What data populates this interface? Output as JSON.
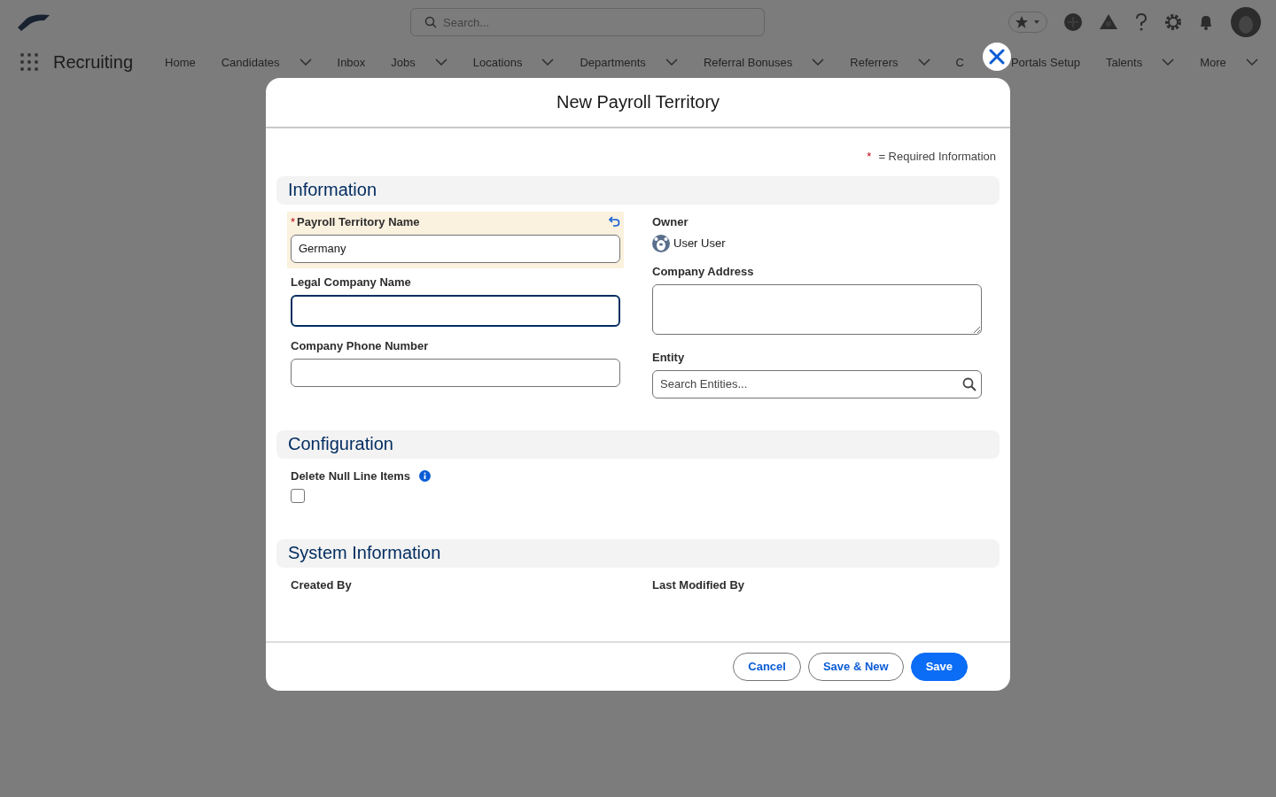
{
  "header": {
    "search": {
      "placeholder": "Search..."
    },
    "app_name": "Recruiting",
    "nav": [
      {
        "label": "Home",
        "dropdown": false
      },
      {
        "label": "Candidates",
        "dropdown": true
      },
      {
        "label": "Inbox",
        "dropdown": false
      },
      {
        "label": "Jobs",
        "dropdown": true
      },
      {
        "label": "Locations",
        "dropdown": true
      },
      {
        "label": "Departments",
        "dropdown": true
      },
      {
        "label": "Referral Bonuses",
        "dropdown": true
      },
      {
        "label": "Referrers",
        "dropdown": true
      },
      {
        "label": "C",
        "dropdown": false
      },
      {
        "label": "Portals Setup",
        "dropdown": false
      },
      {
        "label": "Talents",
        "dropdown": true
      },
      {
        "label": "More",
        "dropdown": true
      }
    ]
  },
  "modal": {
    "title": "New Payroll Territory",
    "required_mark": "*",
    "required_note": "= Required Information",
    "sections": [
      {
        "title": "Information",
        "left": [
          {
            "kind": "text",
            "label": "Payroll Territory Name",
            "required": true,
            "value": "Germany",
            "edited": true,
            "focused": false
          },
          {
            "kind": "text",
            "label": "Legal Company Name",
            "required": false,
            "edited": false,
            "focused": true
          },
          {
            "kind": "text",
            "label": "Company Phone Number",
            "required": false,
            "edited": false,
            "focused": false
          }
        ],
        "right": [
          {
            "kind": "user",
            "label": "Owner",
            "value": "User User"
          },
          {
            "kind": "textarea",
            "label": "Company Address"
          },
          {
            "kind": "search",
            "label": "Entity",
            "placeholder": "Search Entities..."
          }
        ]
      },
      {
        "title": "Configuration",
        "left": [
          {
            "kind": "checkbox",
            "label": "Delete Null Line Items",
            "info": true,
            "checked": false
          }
        ]
      },
      {
        "title": "System Information",
        "left": [
          {
            "kind": "readonly",
            "label": "Created By"
          }
        ],
        "right": [
          {
            "kind": "readonly",
            "label": "Last Modified By"
          }
        ]
      }
    ],
    "buttons": [
      {
        "label": "Cancel",
        "kind": "neutral"
      },
      {
        "label": "Save & New",
        "kind": "neutral"
      },
      {
        "label": "Save",
        "kind": "brand"
      }
    ]
  }
}
